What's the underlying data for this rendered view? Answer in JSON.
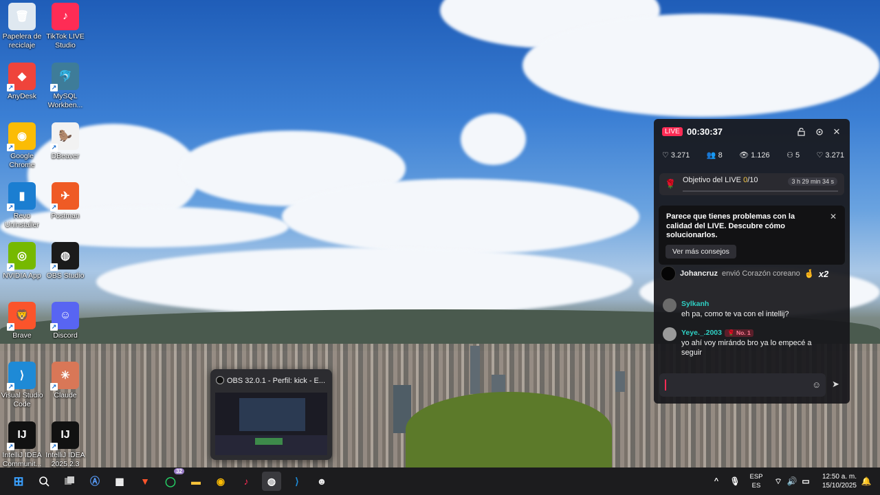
{
  "desktop": {
    "icons": [
      {
        "label": "Papelera de reciclaje",
        "icon": "recycle-bin-icon",
        "glyph": "🗑",
        "color": "#dfe8f0"
      },
      {
        "label": "TikTok LIVE Studio",
        "icon": "tiktok-live-studio-icon",
        "glyph": "♪",
        "color": "#fe2c55"
      },
      {
        "label": "AnyDesk",
        "icon": "anydesk-icon",
        "glyph": "◆",
        "color": "#ef443b"
      },
      {
        "label": "MySQL Workben...",
        "icon": "mysql-workbench-icon",
        "glyph": "🐬",
        "color": "#3e7c99"
      },
      {
        "label": "Google Chrome",
        "icon": "chrome-icon",
        "glyph": "◉",
        "color": "#fbbc05"
      },
      {
        "label": "DBeaver",
        "icon": "dbeaver-icon",
        "glyph": "🦫",
        "color": "#f2f2f2"
      },
      {
        "label": "Revo Uninstaller",
        "icon": "revo-uninstaller-icon",
        "glyph": "▮",
        "color": "#1b7ed1"
      },
      {
        "label": "Postman",
        "icon": "postman-icon",
        "glyph": "✈",
        "color": "#ef5b25"
      },
      {
        "label": "NVIDIA App",
        "icon": "nvidia-icon",
        "glyph": "◎",
        "color": "#76b900"
      },
      {
        "label": "OBS Studio",
        "icon": "obs-studio-icon",
        "glyph": "◍",
        "color": "#1b1b1b"
      },
      {
        "label": "Brave",
        "icon": "brave-icon",
        "glyph": "🦁",
        "color": "#fb542b"
      },
      {
        "label": "Discord",
        "icon": "discord-icon",
        "glyph": "☺",
        "color": "#5865f2"
      },
      {
        "label": "Visual Studio Code",
        "icon": "vscode-icon",
        "glyph": "⟩",
        "color": "#1e8ad6"
      },
      {
        "label": "Claude",
        "icon": "claude-icon",
        "glyph": "✳",
        "color": "#d97757"
      },
      {
        "label": "IntelliJ IDEA Communit...",
        "icon": "intellij-community-icon",
        "glyph": "IJ",
        "color": "#111111"
      },
      {
        "label": "IntelliJ IDEA 2025.2.3",
        "icon": "intellij-ultimate-icon",
        "glyph": "IJ",
        "color": "#111111"
      }
    ]
  },
  "live_panel": {
    "badge": "LIVE",
    "timer": "00:30:37",
    "stats": {
      "likes": "3.271",
      "members": "8",
      "viewers": "1.126",
      "followers": "5",
      "hearts": "3.271"
    },
    "goal": {
      "label_prefix": "Objetivo del LIVE",
      "current": "0",
      "total": "/10",
      "time_left": "3 h 29 min 34 s",
      "progress": 0
    },
    "tip": {
      "text": "Parece que tienes problemas con la calidad del LIVE. Descubre cómo solucionarlos.",
      "button": "Ver más consejos"
    },
    "gift": {
      "user": "Johancruz",
      "text": "envió Corazón coreano",
      "count": "x2"
    },
    "messages": [
      {
        "user": "Sylkanh",
        "text": "eh pa, como te va con el intellij?",
        "rank": ""
      },
      {
        "user": "Yeye._.2003",
        "text": "yo ahí voy mirándo bro ya lo empecé a seguir",
        "rank": "No. 1"
      }
    ],
    "input": {
      "placeholder": ""
    }
  },
  "obs_window": {
    "title": "OBS 32.0.1 - Perfil: kick - E..."
  },
  "taskbar": {
    "whatsapp_badge": "32",
    "lang_top": "ESP",
    "lang_bottom": "ES",
    "time": "12:50 a. m.",
    "date": "15/10/2025"
  },
  "colors": {
    "accent": "#fe2c55",
    "chat_name": "#2fd1c5",
    "goal_highlight": "#f7c948"
  }
}
